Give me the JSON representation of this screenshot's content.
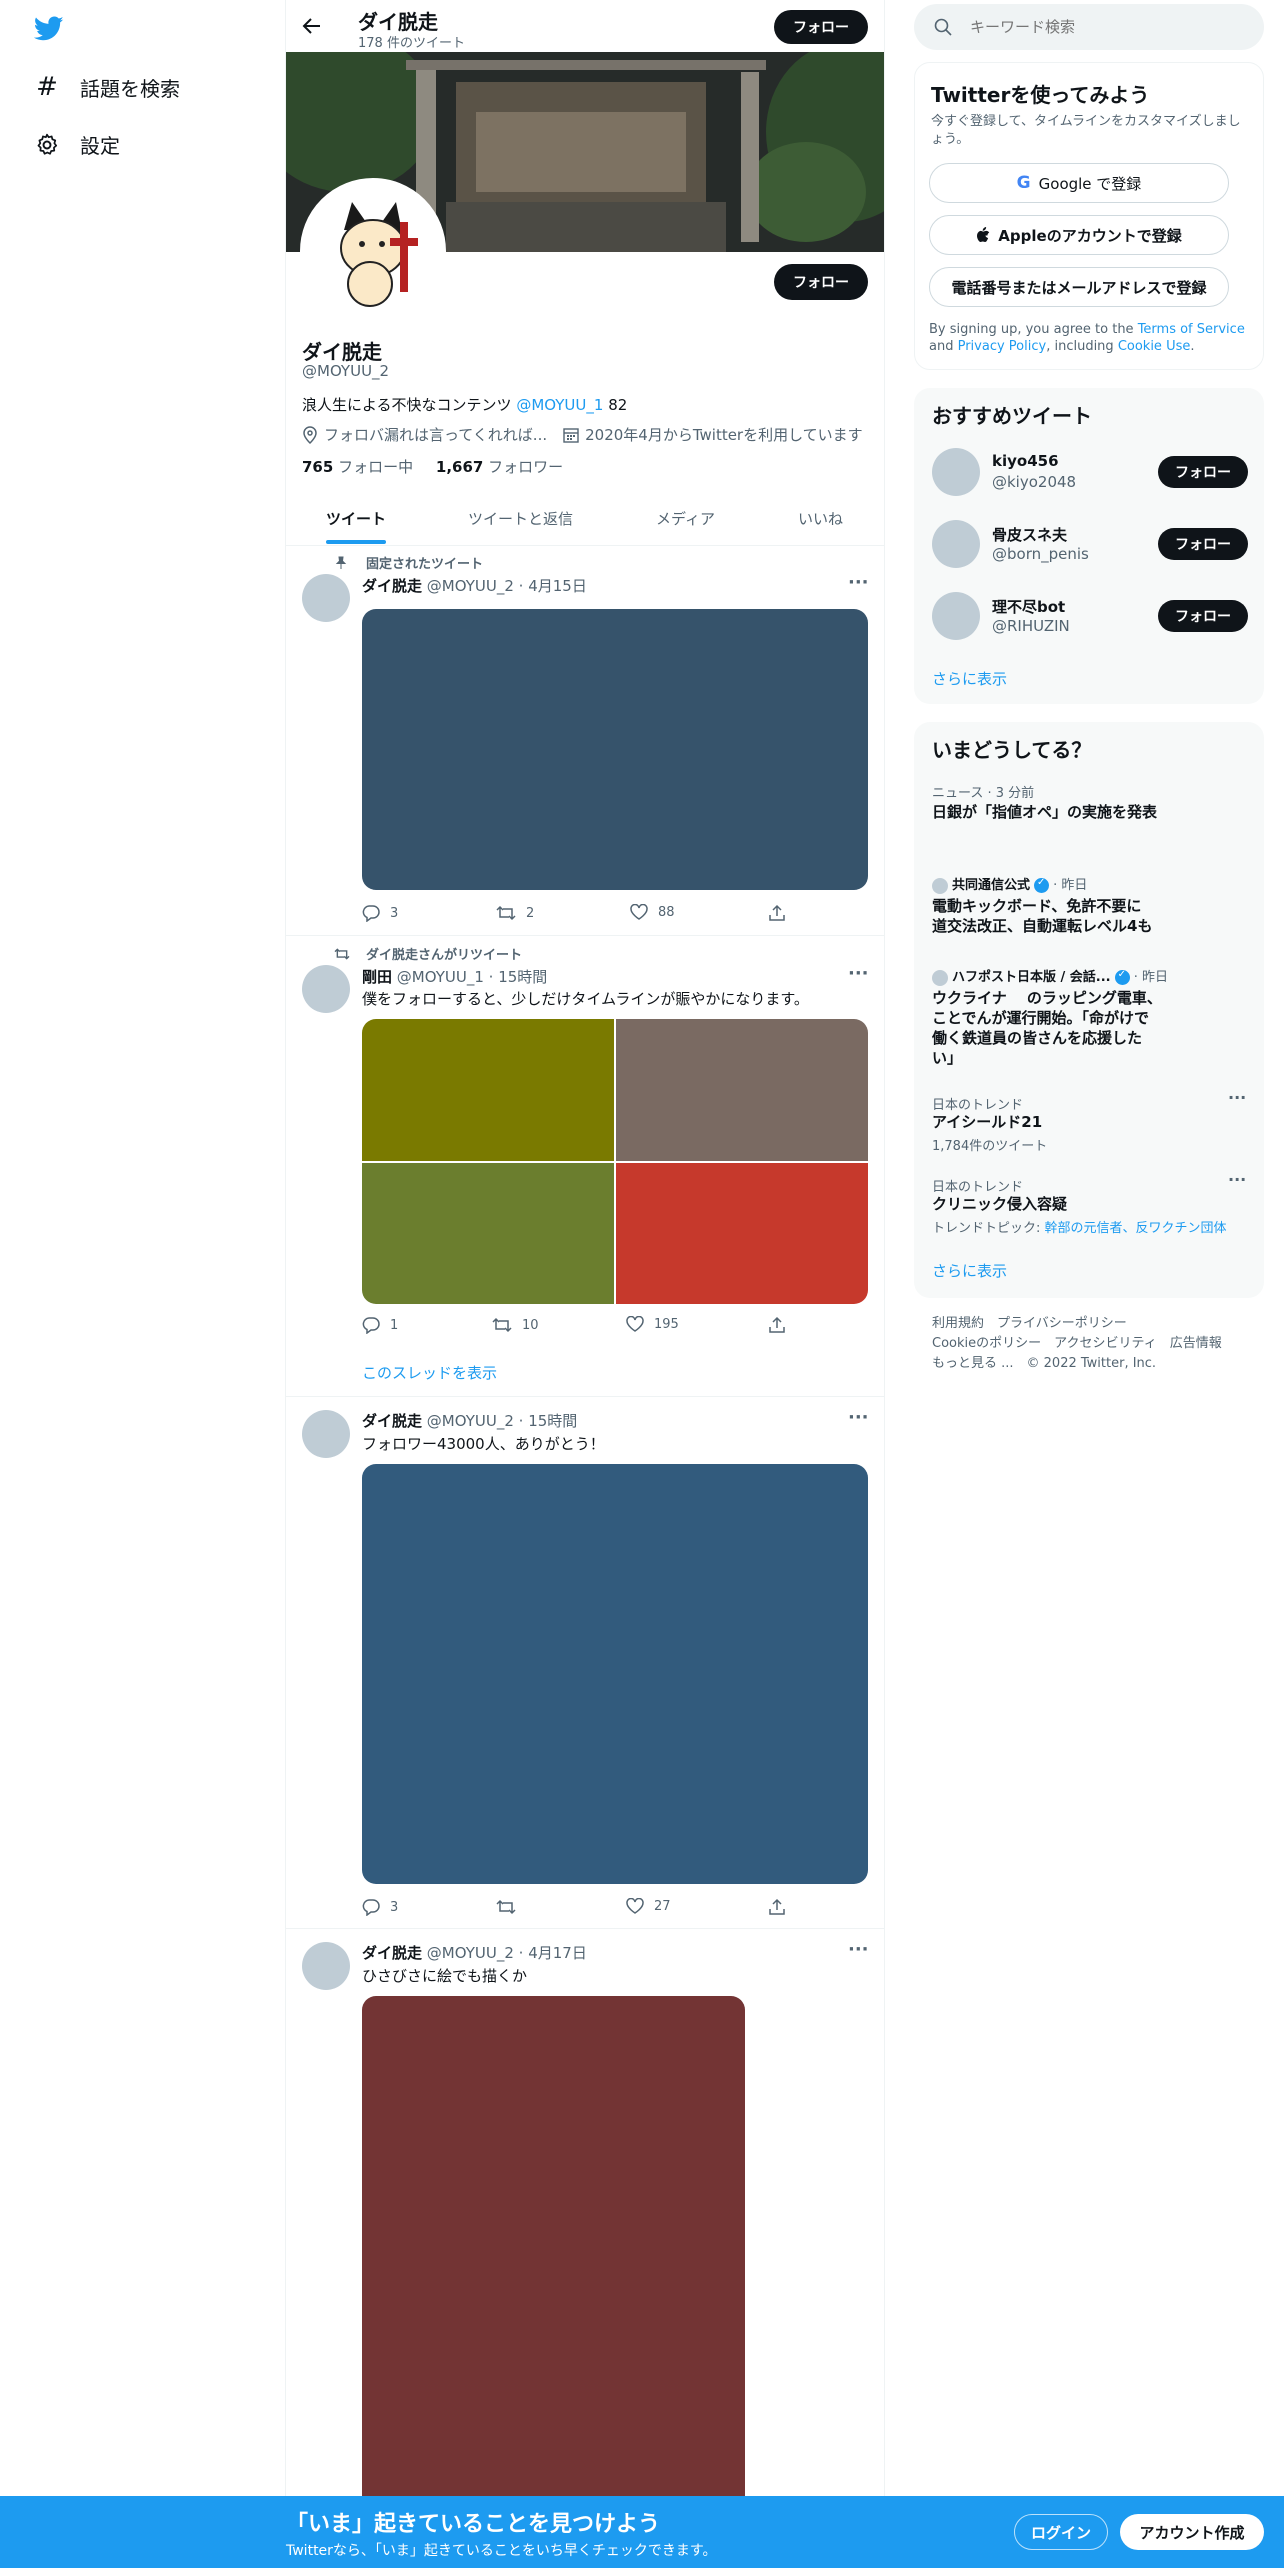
{
  "nav": {
    "explore_label": "話題を検索",
    "settings_label": "設定"
  },
  "header": {
    "name": "ダイ脱走",
    "tweet_count": "178 件のツイート",
    "follow_label": "フォロー"
  },
  "profile": {
    "name": "ダイ脱走",
    "handle": "@MOYUU_2",
    "follow_label": "フォロー",
    "bio_prefix": "浪人生による不快なコンテンツ ",
    "bio_mention": "@MOYUU_1",
    "bio_suffix": " 82",
    "location": "フォロバ漏れは言ってくれれば...",
    "joined": "2020年4月からTwitterを利用しています",
    "following_count": "765",
    "following_label": "フォロー中",
    "followers_count": "1,667",
    "followers_label": "フォロワー"
  },
  "tabs": [
    "ツイート",
    "ツイートと返信",
    "メディア",
    "いいね"
  ],
  "tweets": [
    {
      "context": "固定されたツイート",
      "name": "ダイ脱走",
      "meta": "@MOYUU_2 · 4月15日",
      "text": "",
      "reply": "3",
      "retweet": "2",
      "like": "88",
      "media_color": "#36536b"
    },
    {
      "context": "ダイ脱走さんがリツイート",
      "name": "剛田",
      "meta": "@MOYUU_1 · 15時間",
      "text": "僕をフォローすると、少しだけタイムラインが賑やかになります。",
      "reply": "1",
      "retweet": "10",
      "like": "195",
      "media_colors": [
        "#7a7a00",
        "#7a6a62",
        "#6b7e2e",
        "#c6392c"
      ],
      "thread_link": "このスレッドを表示"
    },
    {
      "name": "ダイ脱走",
      "meta": "@MOYUU_2 · 15時間",
      "text": "フォロワー43000人、ありがとう！",
      "reply": "3",
      "retweet": "",
      "like": "27",
      "media_color": "#325b7d"
    },
    {
      "name": "ダイ脱走",
      "meta": "@MOYUU_2 · 4月17日",
      "text": "ひさびさに絵でも描くか",
      "media_color": "#733434"
    }
  ],
  "search": {
    "placeholder": "キーワード検索"
  },
  "signup": {
    "title": "Twitterを使ってみよう",
    "subtitle": "今すぐ登録して、タイムラインをカスタマイズしましょう。",
    "google": "Google で登録",
    "apple": "Appleのアカウントで登録",
    "phone": "電話番号またはメールアドレスで登録",
    "terms_1": "By signing up, you agree to the ",
    "terms_link1": "Terms of Service",
    "terms_2": " and ",
    "terms_link2": "Privacy Policy",
    "terms_3": ", including ",
    "terms_link3": "Cookie Use",
    "terms_4": "."
  },
  "suggestions": {
    "title": "おすすめツイート",
    "follow_label": "フォロー",
    "more": "さらに表示",
    "users": [
      {
        "name": "kiyo456",
        "handle": "@kiyo2048"
      },
      {
        "name": "骨皮スネ夫",
        "handle": "@born_penis"
      },
      {
        "name": "理不尽bot",
        "handle": "@RIHUZIN"
      }
    ]
  },
  "trends": {
    "title": "いまどうしてる？",
    "more": "さらに表示",
    "items": [
      {
        "label": "ニュース · 3 分前",
        "title": "日銀が「指値オペ」の実施を発表"
      },
      {
        "source": "共同通信公式",
        "time": " · 昨日",
        "title_1": "電動キックボード、免許不要に",
        "title_2": "道交法改正、自動運転レベル4も"
      },
      {
        "source": "ハフポスト日本版 / 会話...",
        "time": " · 昨日",
        "title_1": "ウクライナ　 のラッピング電車、",
        "title_2": "ことでんが運行開始。「命がけで",
        "title_3": "働く鉄道員の皆さんを応援した",
        "title_4": "い」"
      },
      {
        "label": "日本のトレンド",
        "title": "アイシールド21",
        "sub": "1,784件のツイート"
      },
      {
        "label": "日本のトレンド",
        "title": "クリニック侵入容疑",
        "sub_prefix": "トレンドトピック: ",
        "sub_link": "幹部の元信者、反ワクチン団体"
      }
    ]
  },
  "footer": {
    "links_row1": "利用規約　プライバシーポリシー",
    "links_row2": "Cookieのポリシー　アクセシビリティ　広告情報",
    "links_row3": "もっと見る ...　© 2022 Twitter, Inc."
  },
  "bottom_bar": {
    "headline": "「いま」起きていることを見つけよう",
    "sub": "Twitterなら、「いま」起きていることをいち早くチェックできます。",
    "login": "ログイン",
    "signup": "アカウント作成"
  }
}
